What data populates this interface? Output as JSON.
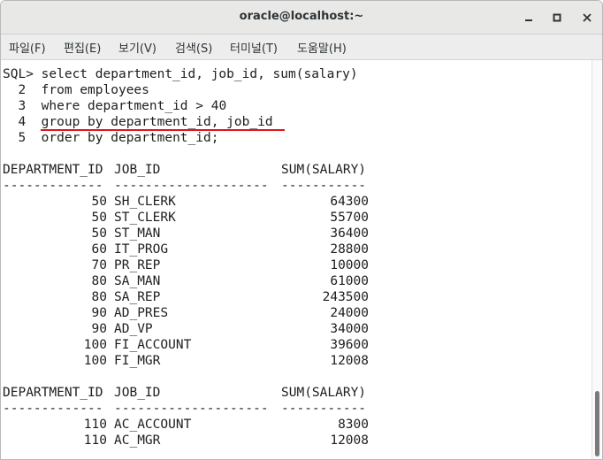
{
  "window": {
    "title": "oracle@localhost:~"
  },
  "menu": [
    "파일(F)",
    "편집(E)",
    "보기(V)",
    "검색(S)",
    "터미널(T)",
    "도움말(H)"
  ],
  "query": [
    {
      "num": "SQL>",
      "text": " select department_id, job_id, sum(salary)"
    },
    {
      "num": "  2",
      "text": "  from employees"
    },
    {
      "num": "  3",
      "text": "  where department_id > 40"
    },
    {
      "num": "  4",
      "text": "  group by department_id, job_id"
    },
    {
      "num": "  5",
      "text": "  order by department_id;"
    }
  ],
  "headers": {
    "dept": "DEPARTMENT_ID",
    "job": "JOB_ID",
    "sum": "SUM(SALARY)"
  },
  "separators": {
    "dept": "-------------",
    "job": "--------------------",
    "sum": "-----------"
  },
  "rows1": [
    {
      "dept": "50",
      "job": "SH_CLERK",
      "sum": "64300"
    },
    {
      "dept": "50",
      "job": "ST_CLERK",
      "sum": "55700"
    },
    {
      "dept": "50",
      "job": "ST_MAN",
      "sum": "36400"
    },
    {
      "dept": "60",
      "job": "IT_PROG",
      "sum": "28800"
    },
    {
      "dept": "70",
      "job": "PR_REP",
      "sum": "10000"
    },
    {
      "dept": "80",
      "job": "SA_MAN",
      "sum": "61000"
    },
    {
      "dept": "80",
      "job": "SA_REP",
      "sum": "243500"
    },
    {
      "dept": "90",
      "job": "AD_PRES",
      "sum": "24000"
    },
    {
      "dept": "90",
      "job": "AD_VP",
      "sum": "34000"
    },
    {
      "dept": "100",
      "job": "FI_ACCOUNT",
      "sum": "39600"
    },
    {
      "dept": "100",
      "job": "FI_MGR",
      "sum": "12008"
    }
  ],
  "rows2": [
    {
      "dept": "110",
      "job": "AC_ACCOUNT",
      "sum": "8300"
    },
    {
      "dept": "110",
      "job": "AC_MGR",
      "sum": "12008"
    }
  ],
  "colors": {
    "highlight_underline": "#e0141e"
  },
  "icons": [
    "minimize-icon",
    "maximize-icon",
    "close-icon"
  ]
}
